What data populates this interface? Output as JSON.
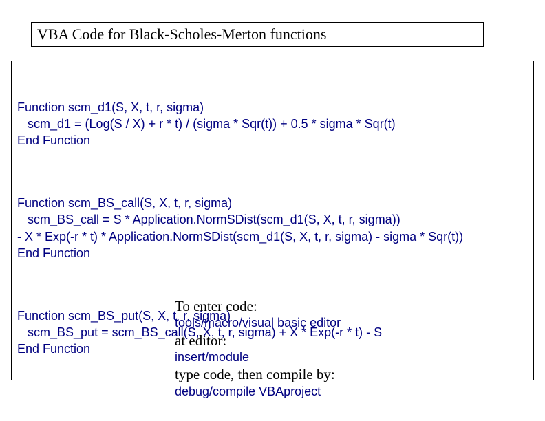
{
  "title": "VBA Code for Black-Scholes-Merton functions",
  "code": {
    "fn1": "Function scm_d1(S, X, t, r, sigma)\n   scm_d1 = (Log(S / X) + r * t) / (sigma * Sqr(t)) + 0.5 * sigma * Sqr(t)\nEnd Function",
    "fn2": "Function scm_BS_call(S, X, t, r, sigma)\n   scm_BS_call = S * Application.NormSDist(scm_d1(S, X, t, r, sigma))\n- X * Exp(-r * t) * Application.NormSDist(scm_d1(S, X, t, r, sigma) - sigma * Sqr(t))\nEnd Function",
    "fn3": "Function scm_BS_put(S, X, t, r, sigma)\n   scm_BS_put = scm_BS_call(S, X, t, r, sigma) + X * Exp(-r * t) - S\nEnd Function"
  },
  "instructions": {
    "line1": "To enter code:",
    "line2": "tools/macro/visual basic editor",
    "line3": "at editor:",
    "line4": "insert/module",
    "line5": "type code, then compile by:",
    "line6": "debug/compile VBAproject"
  }
}
